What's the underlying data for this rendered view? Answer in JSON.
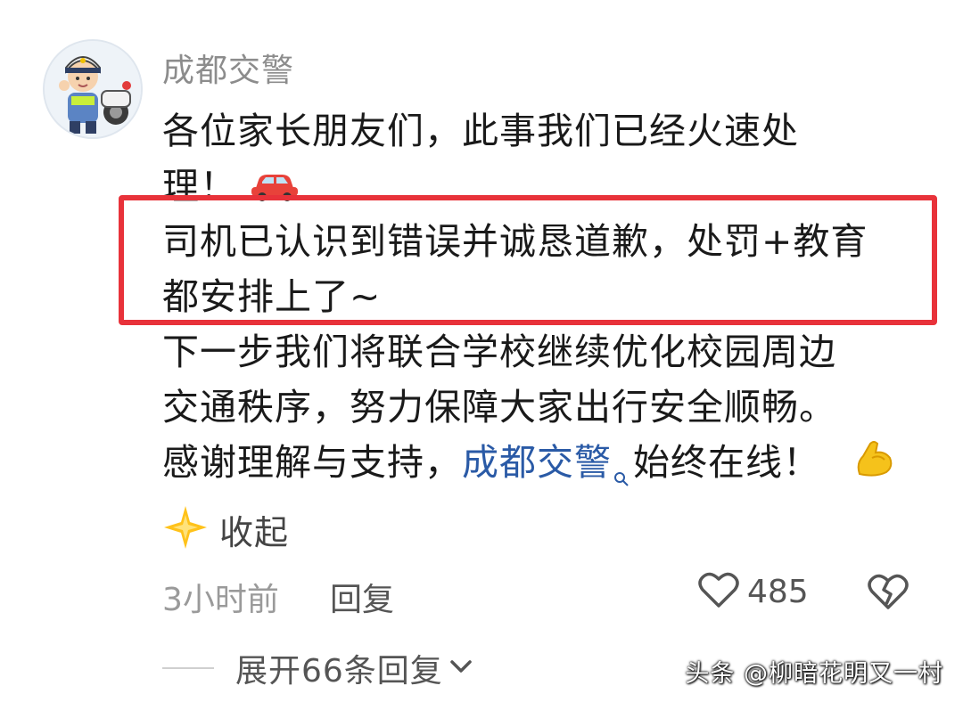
{
  "comment": {
    "username": "成都交警",
    "lines": [
      "各位家长朋友们，此事我们已经火速处",
      "理！",
      "司机已认识到错误并诚恳道歉，处罚+教育",
      "都安排上了~",
      "下一步我们将联合学校继续优化校园周边",
      "交通秩序，努力保障大家出行安全顺畅。"
    ],
    "last_line_prefix": "感谢理解与支持，",
    "mention": "成都交警",
    "last_line_suffix": "始终在线！",
    "emojis": {
      "after_line_2": "car-emoji",
      "end": "flexed-biceps-emoji",
      "collapse": "sparkle-star-emoji"
    },
    "collapse_label": "收起",
    "time": "3小时前",
    "reply_label": "回复",
    "like_count": "485",
    "expand_label": "展开66条回复"
  },
  "watermark": "头条 @柳暗花明又一村",
  "colors": {
    "highlight_border": "#e8323a",
    "mention": "#2a5aa6",
    "username": "#8c8c8c"
  }
}
